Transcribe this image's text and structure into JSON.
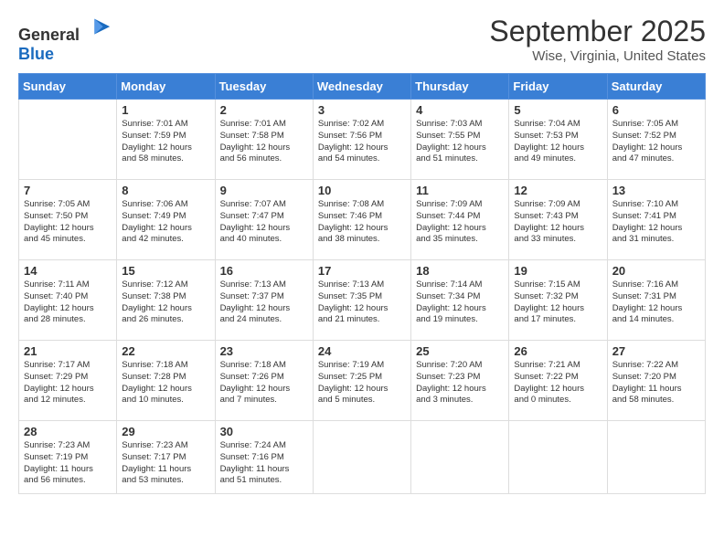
{
  "header": {
    "logo_general": "General",
    "logo_blue": "Blue",
    "month_title": "September 2025",
    "location": "Wise, Virginia, United States"
  },
  "weekdays": [
    "Sunday",
    "Monday",
    "Tuesday",
    "Wednesday",
    "Thursday",
    "Friday",
    "Saturday"
  ],
  "weeks": [
    [
      {
        "day": "",
        "info": ""
      },
      {
        "day": "1",
        "info": "Sunrise: 7:01 AM\nSunset: 7:59 PM\nDaylight: 12 hours\nand 58 minutes."
      },
      {
        "day": "2",
        "info": "Sunrise: 7:01 AM\nSunset: 7:58 PM\nDaylight: 12 hours\nand 56 minutes."
      },
      {
        "day": "3",
        "info": "Sunrise: 7:02 AM\nSunset: 7:56 PM\nDaylight: 12 hours\nand 54 minutes."
      },
      {
        "day": "4",
        "info": "Sunrise: 7:03 AM\nSunset: 7:55 PM\nDaylight: 12 hours\nand 51 minutes."
      },
      {
        "day": "5",
        "info": "Sunrise: 7:04 AM\nSunset: 7:53 PM\nDaylight: 12 hours\nand 49 minutes."
      },
      {
        "day": "6",
        "info": "Sunrise: 7:05 AM\nSunset: 7:52 PM\nDaylight: 12 hours\nand 47 minutes."
      }
    ],
    [
      {
        "day": "7",
        "info": "Sunrise: 7:05 AM\nSunset: 7:50 PM\nDaylight: 12 hours\nand 45 minutes."
      },
      {
        "day": "8",
        "info": "Sunrise: 7:06 AM\nSunset: 7:49 PM\nDaylight: 12 hours\nand 42 minutes."
      },
      {
        "day": "9",
        "info": "Sunrise: 7:07 AM\nSunset: 7:47 PM\nDaylight: 12 hours\nand 40 minutes."
      },
      {
        "day": "10",
        "info": "Sunrise: 7:08 AM\nSunset: 7:46 PM\nDaylight: 12 hours\nand 38 minutes."
      },
      {
        "day": "11",
        "info": "Sunrise: 7:09 AM\nSunset: 7:44 PM\nDaylight: 12 hours\nand 35 minutes."
      },
      {
        "day": "12",
        "info": "Sunrise: 7:09 AM\nSunset: 7:43 PM\nDaylight: 12 hours\nand 33 minutes."
      },
      {
        "day": "13",
        "info": "Sunrise: 7:10 AM\nSunset: 7:41 PM\nDaylight: 12 hours\nand 31 minutes."
      }
    ],
    [
      {
        "day": "14",
        "info": "Sunrise: 7:11 AM\nSunset: 7:40 PM\nDaylight: 12 hours\nand 28 minutes."
      },
      {
        "day": "15",
        "info": "Sunrise: 7:12 AM\nSunset: 7:38 PM\nDaylight: 12 hours\nand 26 minutes."
      },
      {
        "day": "16",
        "info": "Sunrise: 7:13 AM\nSunset: 7:37 PM\nDaylight: 12 hours\nand 24 minutes."
      },
      {
        "day": "17",
        "info": "Sunrise: 7:13 AM\nSunset: 7:35 PM\nDaylight: 12 hours\nand 21 minutes."
      },
      {
        "day": "18",
        "info": "Sunrise: 7:14 AM\nSunset: 7:34 PM\nDaylight: 12 hours\nand 19 minutes."
      },
      {
        "day": "19",
        "info": "Sunrise: 7:15 AM\nSunset: 7:32 PM\nDaylight: 12 hours\nand 17 minutes."
      },
      {
        "day": "20",
        "info": "Sunrise: 7:16 AM\nSunset: 7:31 PM\nDaylight: 12 hours\nand 14 minutes."
      }
    ],
    [
      {
        "day": "21",
        "info": "Sunrise: 7:17 AM\nSunset: 7:29 PM\nDaylight: 12 hours\nand 12 minutes."
      },
      {
        "day": "22",
        "info": "Sunrise: 7:18 AM\nSunset: 7:28 PM\nDaylight: 12 hours\nand 10 minutes."
      },
      {
        "day": "23",
        "info": "Sunrise: 7:18 AM\nSunset: 7:26 PM\nDaylight: 12 hours\nand 7 minutes."
      },
      {
        "day": "24",
        "info": "Sunrise: 7:19 AM\nSunset: 7:25 PM\nDaylight: 12 hours\nand 5 minutes."
      },
      {
        "day": "25",
        "info": "Sunrise: 7:20 AM\nSunset: 7:23 PM\nDaylight: 12 hours\nand 3 minutes."
      },
      {
        "day": "26",
        "info": "Sunrise: 7:21 AM\nSunset: 7:22 PM\nDaylight: 12 hours\nand 0 minutes."
      },
      {
        "day": "27",
        "info": "Sunrise: 7:22 AM\nSunset: 7:20 PM\nDaylight: 11 hours\nand 58 minutes."
      }
    ],
    [
      {
        "day": "28",
        "info": "Sunrise: 7:23 AM\nSunset: 7:19 PM\nDaylight: 11 hours\nand 56 minutes."
      },
      {
        "day": "29",
        "info": "Sunrise: 7:23 AM\nSunset: 7:17 PM\nDaylight: 11 hours\nand 53 minutes."
      },
      {
        "day": "30",
        "info": "Sunrise: 7:24 AM\nSunset: 7:16 PM\nDaylight: 11 hours\nand 51 minutes."
      },
      {
        "day": "",
        "info": ""
      },
      {
        "day": "",
        "info": ""
      },
      {
        "day": "",
        "info": ""
      },
      {
        "day": "",
        "info": ""
      }
    ]
  ]
}
